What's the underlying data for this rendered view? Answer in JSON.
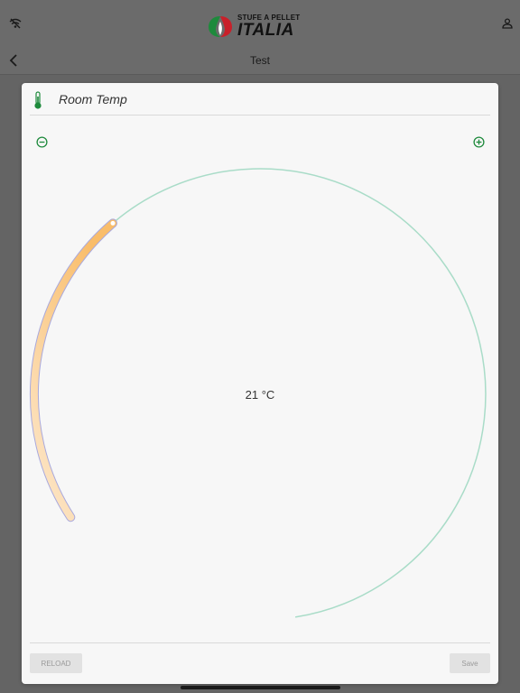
{
  "app": {
    "logo_top_text": "STUFE A PELLET",
    "logo_main_text": "ITALIA",
    "page_title": "Test"
  },
  "icons": {
    "wifi": "wifi-off-icon",
    "user": "user-icon",
    "back": "chevron-left-icon",
    "thermometer": "thermometer-icon",
    "minus": "minus-circle-icon",
    "plus": "plus-circle-icon"
  },
  "card": {
    "title": "Room Temp",
    "temperature_display": "21 °C",
    "setpoint_fraction": 0.28
  },
  "buttons": {
    "reload_label": "RELOAD",
    "save_label": "Save"
  },
  "colors": {
    "accent_green": "#1e8a3c",
    "gauge_track": "#a9dcc8",
    "gauge_fill_start": "#fde9cf",
    "gauge_fill_end": "#f9bd6a",
    "gauge_outline": "#a9a9dd"
  }
}
